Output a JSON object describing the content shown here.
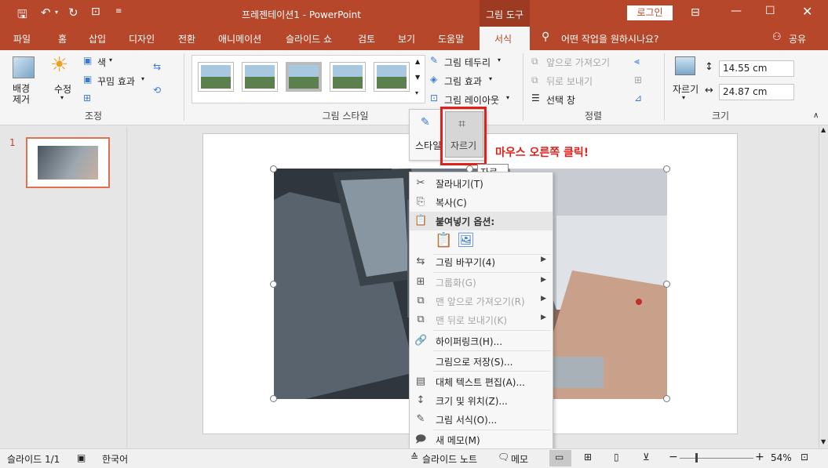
{
  "title": {
    "doc": "프레젠테이션1 - PowerPoint",
    "context_tab": "그림 도구",
    "login": "로그인"
  },
  "tabs": [
    "파일",
    "홈",
    "삽입",
    "디자인",
    "전환",
    "애니메이션",
    "슬라이드 쇼",
    "검토",
    "보기",
    "도움말",
    "서식"
  ],
  "tell_me": "어떤 작업을 원하시나요?",
  "share": "공유",
  "ribbon": {
    "remove_bg": "배경\n제거",
    "corrections": "수정",
    "color": "색",
    "artistic": "꾸밈 효과",
    "group_adjust": "조정",
    "group_styles": "그림 스타일",
    "border": "그림 테두리",
    "effects": "그림 효과",
    "layout": "그림 레이아웃",
    "bring_forward": "앞으로 가져오기",
    "send_backward": "뒤로 보내기",
    "selection_pane": "선택 창",
    "group_arrange": "정렬",
    "crop": "자르기",
    "height": "14.55 cm",
    "width": "24.87 cm",
    "group_size": "크기"
  },
  "popup": {
    "style": "스타일",
    "crop": "자르기",
    "tooltip": "자르기"
  },
  "annotation": "마우스 오른쪽 클릭!",
  "slide_number": "1",
  "context_menu": [
    {
      "label": "잘라내기(T)",
      "icon": "scissors-icon",
      "disabled": false
    },
    {
      "label": "복사(C)",
      "icon": "copy-icon",
      "disabled": false
    },
    {
      "label": "붙여넣기 옵션:",
      "icon": "paste-icon",
      "disabled": false,
      "header": true
    },
    {
      "label": "그림 바꾸기(4)",
      "icon": "change-picture-icon",
      "disabled": false,
      "submenu": true
    },
    {
      "label": "그룹화(G)",
      "icon": "group-icon",
      "disabled": true,
      "submenu": true
    },
    {
      "label": "맨 앞으로 가져오기(R)",
      "icon": "bring-front-icon",
      "disabled": true,
      "submenu": true
    },
    {
      "label": "맨 뒤로 보내기(K)",
      "icon": "send-back-icon",
      "disabled": true,
      "submenu": true
    },
    {
      "label": "하이퍼링크(H)...",
      "icon": "hyperlink-icon",
      "disabled": false
    },
    {
      "label": "그림으로 저장(S)...",
      "icon": "",
      "disabled": false
    },
    {
      "label": "대체 텍스트 편집(A)...",
      "icon": "alt-text-icon",
      "disabled": false
    },
    {
      "label": "크기 및 위치(Z)...",
      "icon": "size-position-icon",
      "disabled": false
    },
    {
      "label": "그림 서식(O)...",
      "icon": "format-picture-icon",
      "disabled": false
    },
    {
      "label": "새 메모(M)",
      "icon": "new-comment-icon",
      "disabled": false
    }
  ],
  "status": {
    "slide": "슬라이드 1/1",
    "lang": "한국어",
    "notes": "슬라이드 노트",
    "comments": "메모",
    "zoom": "54%"
  },
  "colors": {
    "accent": "#b7472a",
    "highlight": "#e0201a"
  }
}
